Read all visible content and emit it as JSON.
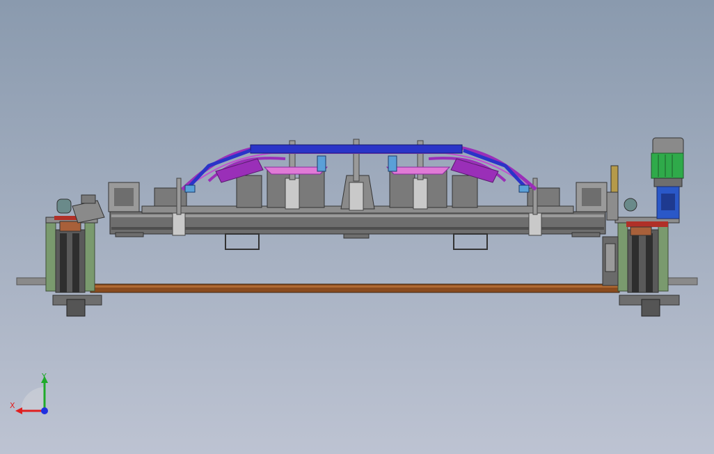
{
  "viewport": {
    "background_top": "#8a9aae",
    "background_bottom": "#bdc3d2"
  },
  "colors": {
    "frame_dark": "#3e3e3e",
    "frame_mid": "#6e6e6e",
    "frame_light": "#8d8d8d",
    "green_column": "#7a9a6e",
    "rail_brown": "#8a4b1e",
    "fixture_blue": "#2a34c8",
    "fixture_magenta": "#9a2fb8",
    "fixture_pink": "#e07ad6",
    "motor_green": "#2faa4a",
    "motor_blue": "#2a58c8",
    "red_plate": "#b03028",
    "cylinder_silver": "#c9c9c9"
  },
  "triad": {
    "x_label": "X",
    "y_label": "Y",
    "x_color": "#e02020",
    "y_color": "#1faa2a",
    "z_color": "#2030e0"
  }
}
